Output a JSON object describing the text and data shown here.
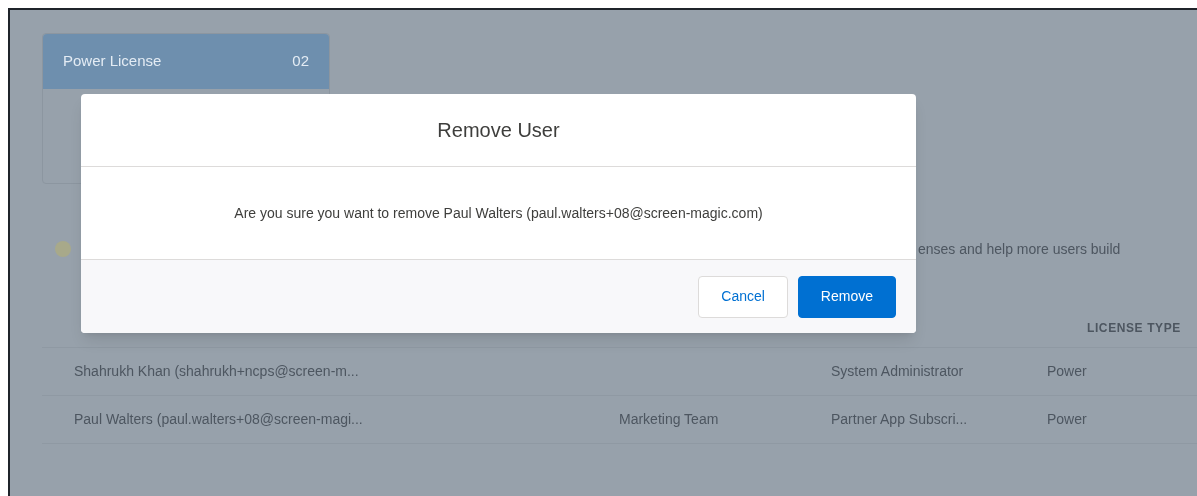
{
  "license_card": {
    "title": "Power License",
    "count": "02"
  },
  "notice": {
    "text": "enses and help more users build"
  },
  "table": {
    "columns": [
      {
        "label": "LICENSE TYPE"
      }
    ],
    "rows": [
      {
        "user": "Shahrukh Khan (shahrukh+ncps@screen-m...",
        "profile": "System Administrator",
        "license_type": "Power"
      },
      {
        "user": "Paul Walters (paul.walters+08@screen-magi...",
        "column_2": "Marketing Team",
        "profile": "Partner App Subscri...",
        "license_type": "Power"
      }
    ]
  },
  "dialog": {
    "title": "Remove User",
    "message": "Are you sure you want to remove Paul Walters (paul.walters+08@screen-magic.com)",
    "buttons": [
      {
        "label": "Cancel",
        "kind": "neutral"
      },
      {
        "label": "Remove",
        "kind": "brand"
      }
    ]
  }
}
